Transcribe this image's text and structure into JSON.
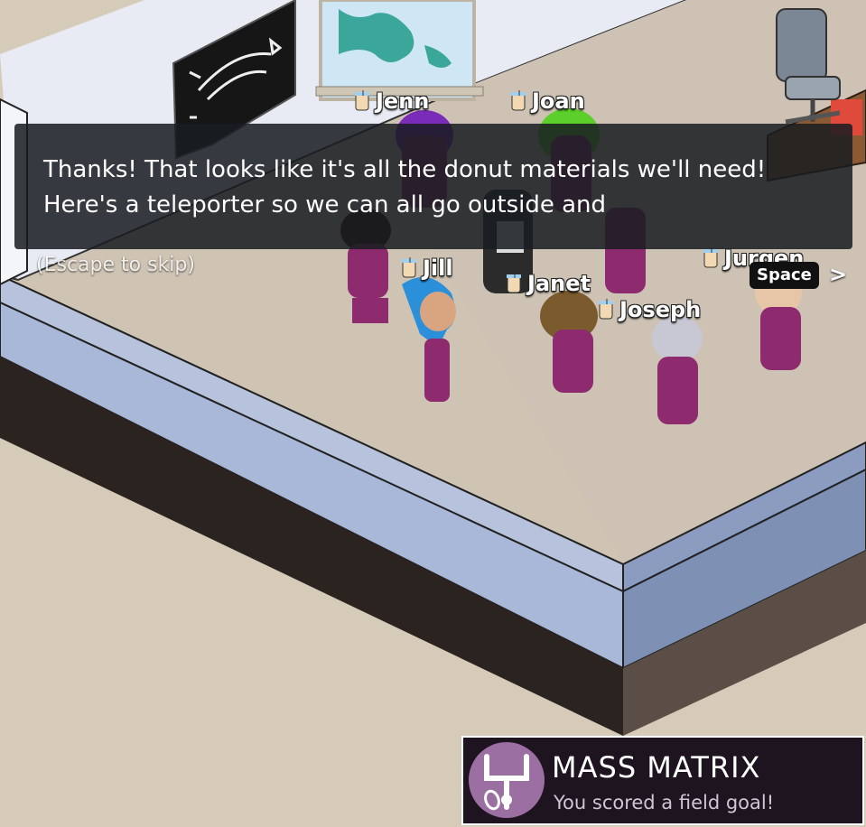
{
  "dialog": {
    "text": "Thanks! That looks like it's all the donut materials we'll need! Here's a teleporter so we can all go outside and",
    "escape_hint": "(Escape to skip)",
    "continue_key": "Space",
    "continue_arrow": ">"
  },
  "characters": [
    {
      "name": "Jenn"
    },
    {
      "name": "Joan"
    },
    {
      "name": "Jill"
    },
    {
      "name": "Janet"
    },
    {
      "name": "Joseph"
    },
    {
      "name": "Jurgen"
    }
  ],
  "achievement": {
    "title": "MASS MATRIX",
    "subtitle": "You scored a field goal!",
    "icon": "goalpost-icon"
  },
  "colors": {
    "uniform": "#8e2a6e",
    "floor": "#cdc3b4",
    "wall_blue": "#a9b8d8",
    "dialog_bg": "#191c21",
    "achievement_badge": "#9b6fa1"
  }
}
